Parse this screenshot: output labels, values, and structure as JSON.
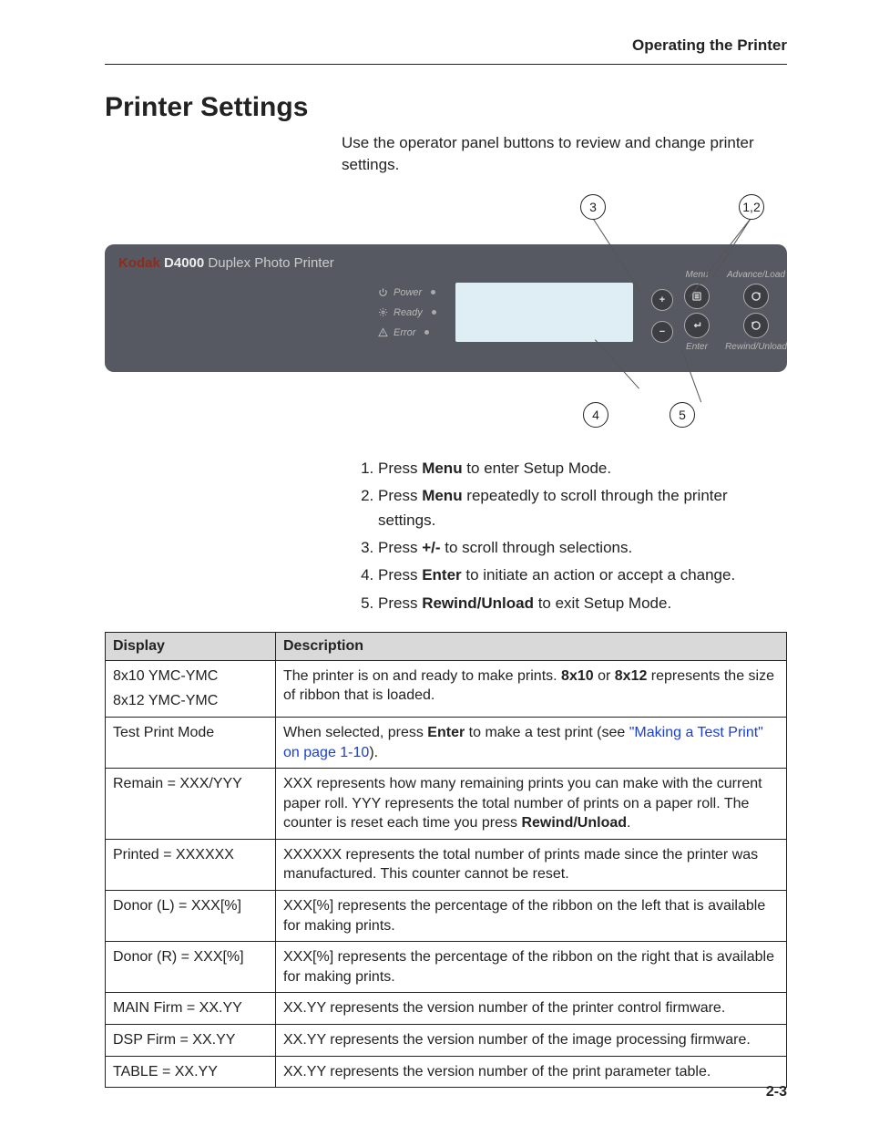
{
  "running_header": "Operating the Printer",
  "title": "Printer Settings",
  "intro": "Use the operator panel buttons to review and change printer settings.",
  "callouts": {
    "c3": "3",
    "c12": "1,2",
    "c4": "4",
    "c5": "5"
  },
  "panel": {
    "brand": "Kodak",
    "model": "D4000",
    "subtitle": "Duplex Photo Printer",
    "leds": {
      "power": "Power",
      "ready": "Ready",
      "error": "Error"
    },
    "labels": {
      "menu": "Menu",
      "advance": "Advance/Load",
      "enter": "Enter",
      "rewind": "Rewind/Unload"
    }
  },
  "steps": [
    {
      "pre": "Press ",
      "bold": "Menu",
      "post": " to enter Setup Mode."
    },
    {
      "pre": "Press ",
      "bold": "Menu",
      "post": " repeatedly to scroll through the printer settings."
    },
    {
      "pre": "Press ",
      "bold": "+/-",
      "post": " to scroll through selections."
    },
    {
      "pre": "Press ",
      "bold": "Enter",
      "post": " to initiate an action or accept a change."
    },
    {
      "pre": "Press ",
      "bold": "Rewind/Unload",
      "post": " to exit Setup Mode."
    }
  ],
  "table": {
    "headers": {
      "display": "Display",
      "description": "Description"
    },
    "rows": {
      "r1": {
        "display_line1": "8x10 YMC-YMC",
        "display_line2": "8x12 YMC-YMC",
        "desc_pre": "The printer is on and ready to make prints. ",
        "b1": "8x10",
        "mid": " or ",
        "b2": "8x12",
        "desc_post": " represents the size of ribbon that is loaded."
      },
      "r2": {
        "display": "Test Print Mode",
        "pre": "When selected, press ",
        "bold": "Enter",
        "mid": " to make a test print (see ",
        "link": "\"Making a Test Print\" on page 1-10",
        "post": ")."
      },
      "r3": {
        "display": "Remain = XXX/YYY",
        "pre": "XXX represents how many remaining prints you can make with the current paper roll. YYY represents the total number of prints on a paper roll. The counter is reset each time you press ",
        "bold": "Rewind/Unload",
        "post": "."
      },
      "r4": {
        "display": "Printed = XXXXXX",
        "desc": "XXXXXX represents the total number of prints made since the printer was manufactured. This counter cannot be reset."
      },
      "r5": {
        "display": "Donor (L) = XXX[%]",
        "desc": "XXX[%] represents the percentage of the ribbon on the left that is available for making prints."
      },
      "r6": {
        "display": "Donor (R) = XXX[%]",
        "desc": "XXX[%] represents the percentage of the ribbon on the right that is available for making prints."
      },
      "r7": {
        "display": "MAIN Firm = XX.YY",
        "desc": "XX.YY represents the version number of the printer control firmware."
      },
      "r8": {
        "display": "DSP Firm = XX.YY",
        "desc": "XX.YY represents the version number of the image processing firmware."
      },
      "r9": {
        "display": "TABLE = XX.YY",
        "desc": "XX.YY represents the version number of the print parameter table."
      }
    }
  },
  "page_number": "2-3"
}
